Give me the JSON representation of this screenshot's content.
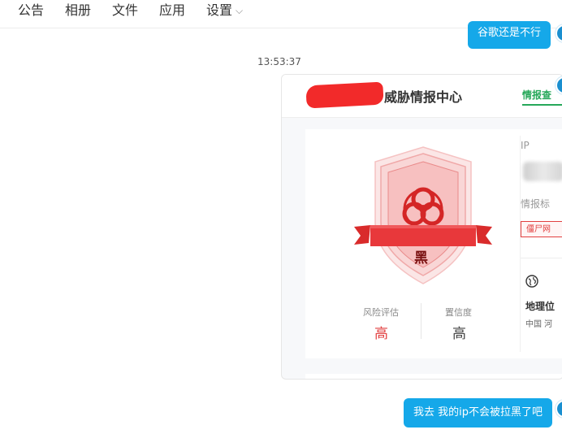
{
  "tabs": [
    "公告",
    "相册",
    "文件",
    "应用",
    "设置"
  ],
  "settings_chevron": "⌵",
  "messages": {
    "top_bubble": "谷歌还是不行",
    "timestamp": "13:53:37",
    "bottom_bubble": "我去 我的ip不会被拉黑了吧"
  },
  "card": {
    "header_title": "威胁情报中心",
    "header_tab": "情报查",
    "badge_text": "黑",
    "risk_label": "风险评估",
    "risk_value": "高",
    "confidence_label": "置信度",
    "confidence_value": "高",
    "ip_label": "IP",
    "intel_label": "情报标",
    "tag_text": "僵尸网",
    "geo_label": "地理位",
    "geo_value": "中国 河"
  },
  "colors": {
    "bubble": "#15a8e9",
    "danger": "#e24040",
    "active_tab": "#27a85a"
  },
  "icons": [
    "chevron-down-icon",
    "biohazard-icon",
    "globe-icon"
  ]
}
